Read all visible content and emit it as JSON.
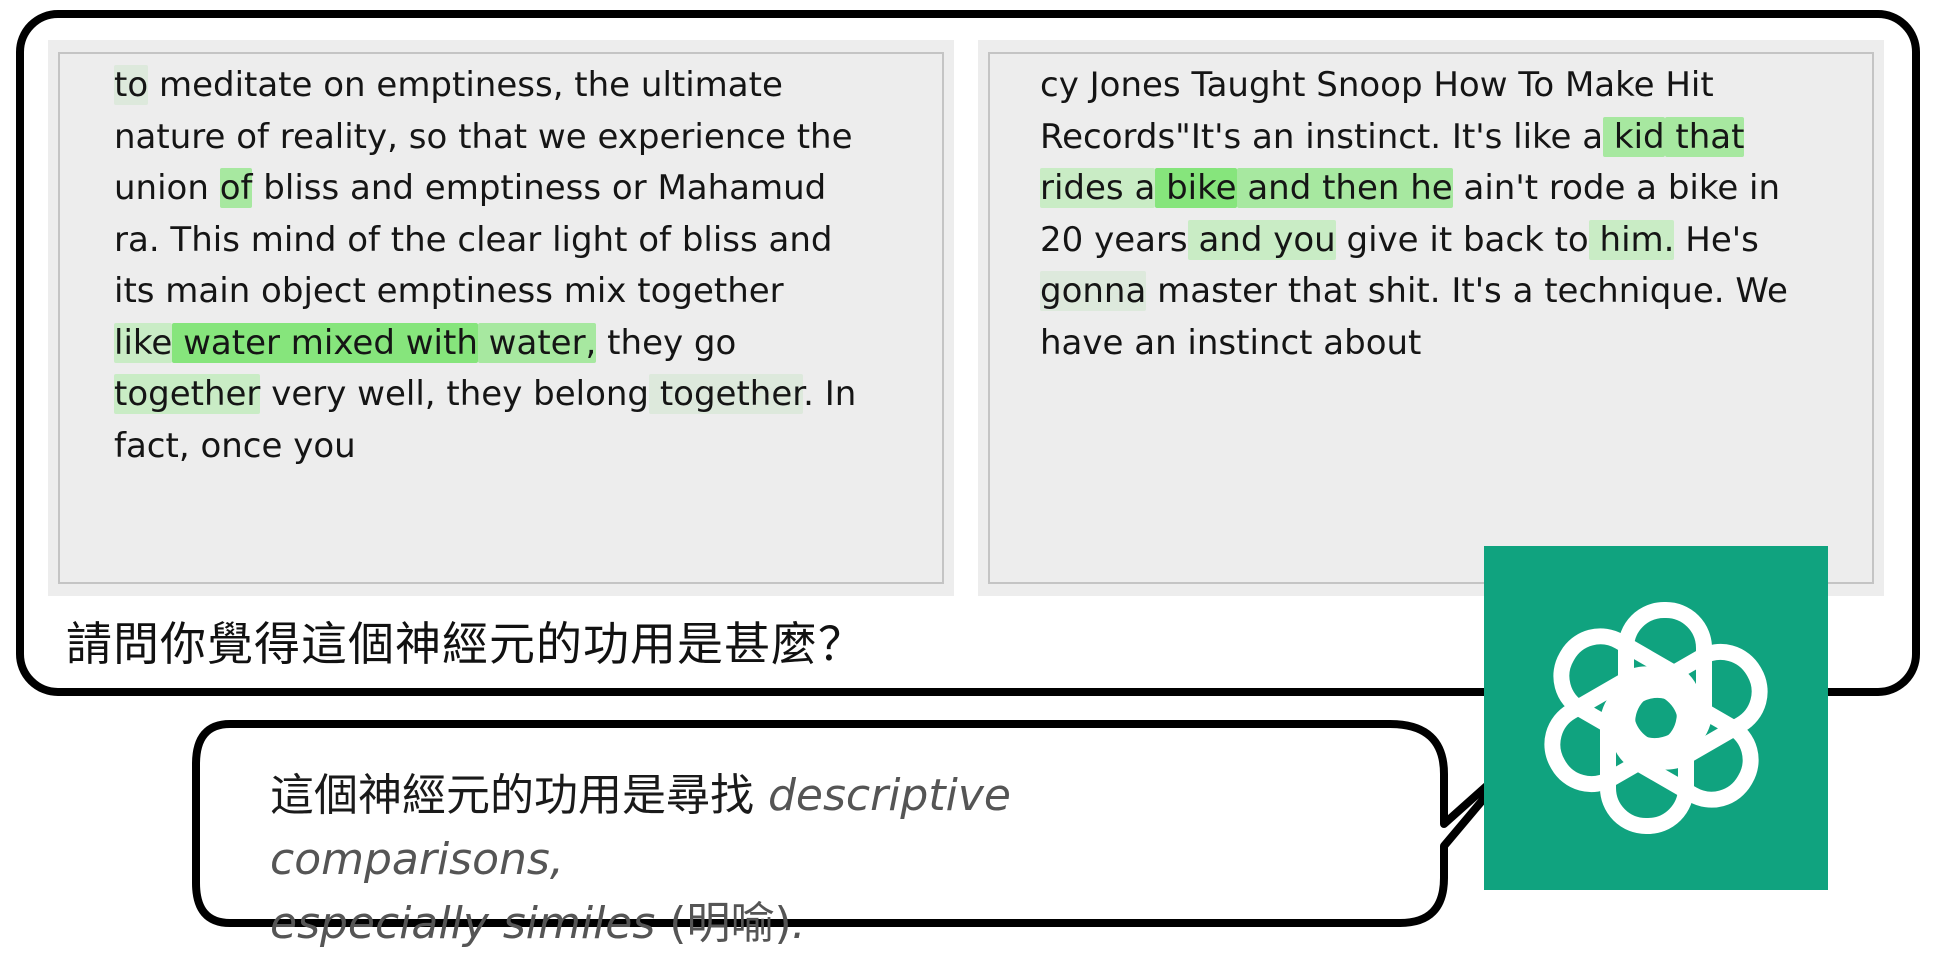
{
  "left_passage": {
    "lines": [
      [
        {
          "t": "to",
          "h": 1
        },
        {
          "t": " meditate on emptiness, the ultimate",
          "h": 0
        }
      ],
      [
        {
          "t": "nature of reality, so that we experience the",
          "h": 0
        }
      ],
      [
        {
          "t": "union ",
          "h": 0
        },
        {
          "t": "of",
          "h": 3
        },
        {
          "t": " bliss and emptiness or Mahamud",
          "h": 0
        }
      ],
      [
        {
          "t": "ra. This mind of the clear light of bliss and",
          "h": 0
        }
      ],
      [
        {
          "t": "its main object emptiness mix together",
          "h": 0
        }
      ],
      [
        {
          "t": "like",
          "h": 2
        },
        {
          "t": " water mixed with",
          "h": 4
        },
        {
          "t": " water,",
          "h": 3
        },
        {
          "t": " they go",
          "h": 0
        }
      ],
      [
        {
          "t": "together",
          "h": 2
        },
        {
          "t": " very well, they belong",
          "h": 0
        },
        {
          "t": " together",
          "h": 1
        },
        {
          "t": ". In",
          "h": 0
        }
      ],
      [
        {
          "t": "fact, once you",
          "h": 0
        }
      ]
    ]
  },
  "right_passage": {
    "lines": [
      [
        {
          "t": "cy Jones Taught Snoop How To Make Hit",
          "h": 0
        }
      ],
      [
        {
          "t": "Records\"It's an instinct. It's like a",
          "h": 0
        },
        {
          "t": " kid",
          "h": 3
        },
        {
          "t": " that",
          "h": 3
        }
      ],
      [
        {
          "t": "rides a",
          "h": 2
        },
        {
          "t": " bike",
          "h": 4
        },
        {
          "t": " and then he",
          "h": 3
        },
        {
          "t": " ain't rode a bike in",
          "h": 0
        }
      ],
      [
        {
          "t": "20 years",
          "h": 0
        },
        {
          "t": " and you",
          "h": 2
        },
        {
          "t": " give it back to",
          "h": 0
        },
        {
          "t": " him.",
          "h": 2
        },
        {
          "t": " He's",
          "h": 0
        }
      ],
      [
        {
          "t": "gonna",
          "h": 1
        },
        {
          "t": " master that shit. It's a technique. We",
          "h": 0
        }
      ],
      [
        {
          "t": "have an instinct about",
          "h": 0
        }
      ]
    ]
  },
  "question": "請問你覺得這個神經元的功用是甚麼？",
  "answer": {
    "prefix": "這個神經元的功用是尋找 ",
    "italic_1": "descriptive comparisons,",
    "italic_2": "especially similes",
    "paren": " (明喻)",
    "suffix": "."
  },
  "logo_icon": "openai-logo-icon",
  "colors": {
    "logo_bg": "#10a37f",
    "highlight_light": "#dde9dc",
    "highlight_mid": "#c9ecc5",
    "highlight_strong": "#a7e8a0",
    "highlight_max": "#86e57c"
  }
}
